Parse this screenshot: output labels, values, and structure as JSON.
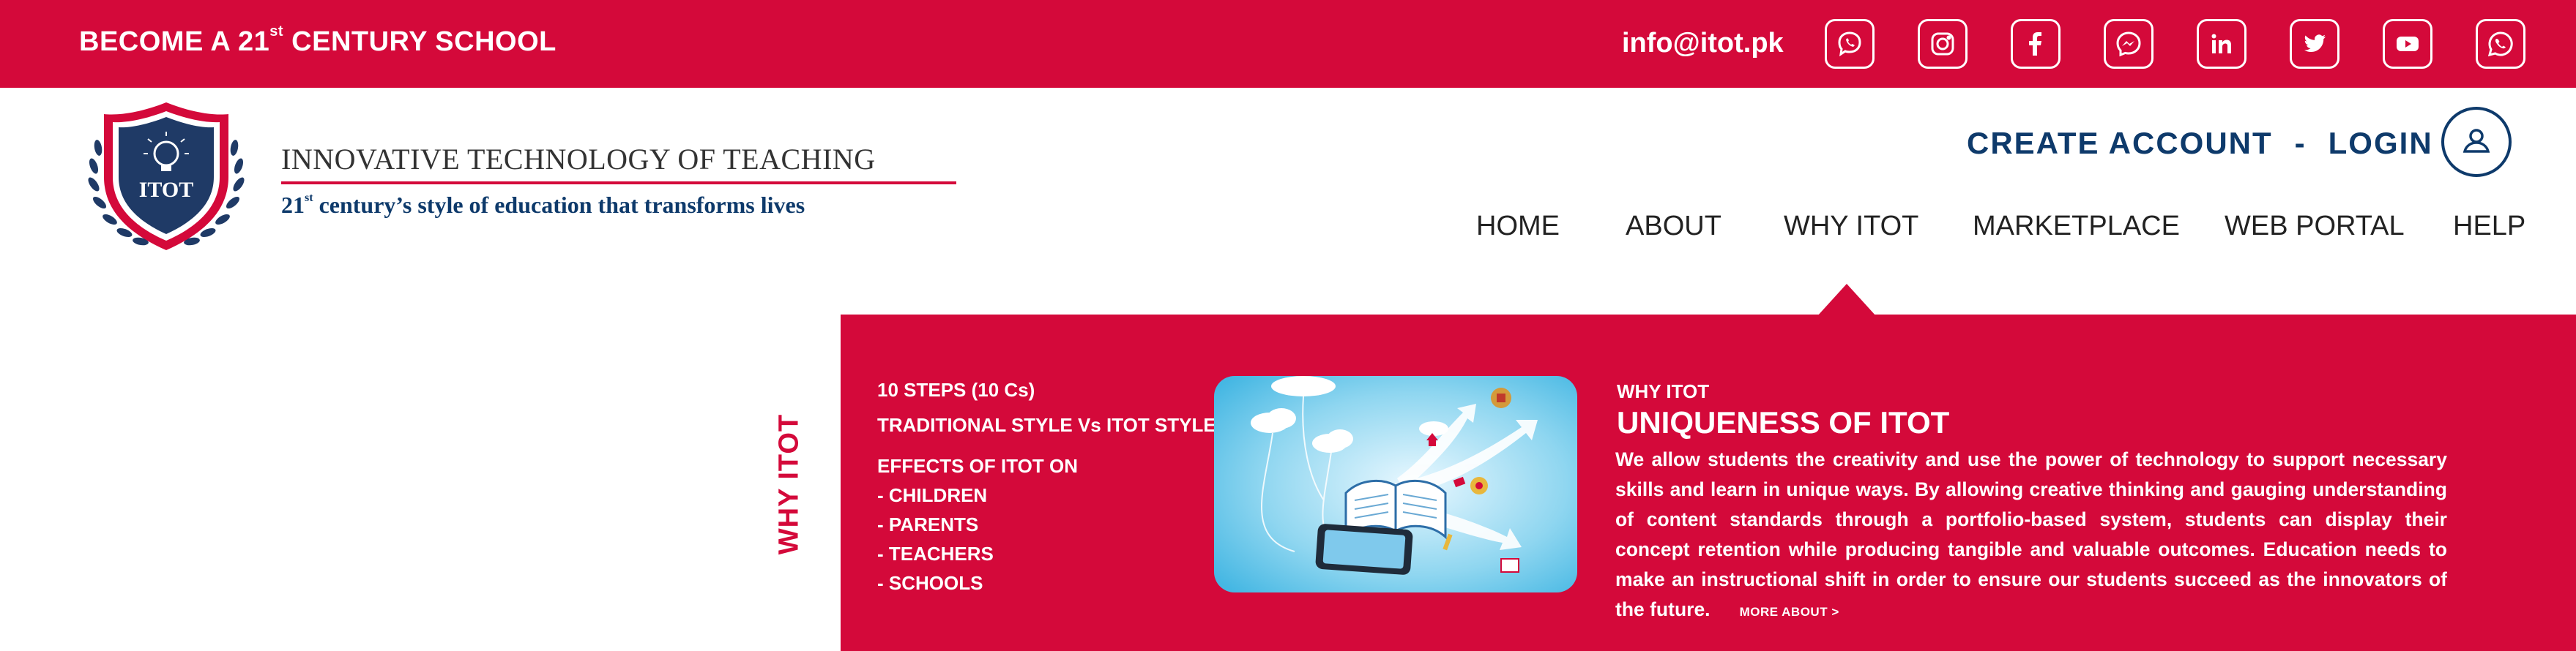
{
  "topbar": {
    "tagline_prefix": "BECOME A 21",
    "tagline_sup": "st",
    "tagline_suffix": " CENTURY SCHOOL",
    "email": "info@itot.pk",
    "social_icons": [
      "viber-icon",
      "instagram-icon",
      "facebook-icon",
      "messenger-icon",
      "linkedin-icon",
      "twitter-icon",
      "youtube-icon",
      "whatsapp-icon"
    ]
  },
  "brand": {
    "badge_text": "ITOT",
    "title": "INNOVATIVE TECHNOLOGY OF TEACHING",
    "subtitle_prefix": "21",
    "subtitle_sup": "st",
    "subtitle_suffix": " century’s style of education that transforms lives"
  },
  "account": {
    "create": "CREATE ACCOUNT",
    "separator": "-",
    "login": "LOGIN"
  },
  "nav": [
    "HOME",
    "ABOUT",
    "WHY ITOT",
    "MARKETPLACE",
    "WEB PORTAL",
    "HELP"
  ],
  "dropdown": {
    "side_label": "WHY ITOT",
    "menu": [
      "10 STEPS (10 Cs)",
      "TRADITIONAL STYLE Vs ITOT STYLE",
      "EFFECTS OF ITOT ON",
      "- CHILDREN",
      "- PARENTS",
      "- TEACHERS",
      "- SCHOOLS"
    ],
    "section_label": "WHY ITOT",
    "title": "UNIQUENESS OF ITOT",
    "body": "We allow students the creativity and use the power of technology to support necessary skills and learn in unique ways. By allowing creative thinking and gauging understanding of content standards through a portfolio-based system, students can display their concept retention while producing tangible and valuable outcomes. Education needs to make an instructional shift in order to ensure our students succeed as the innovators of the future.",
    "more_link": "MORE ABOUT >"
  },
  "colors": {
    "primary_red": "#d4093a",
    "navy": "#0e3a6b",
    "white": "#ffffff"
  }
}
